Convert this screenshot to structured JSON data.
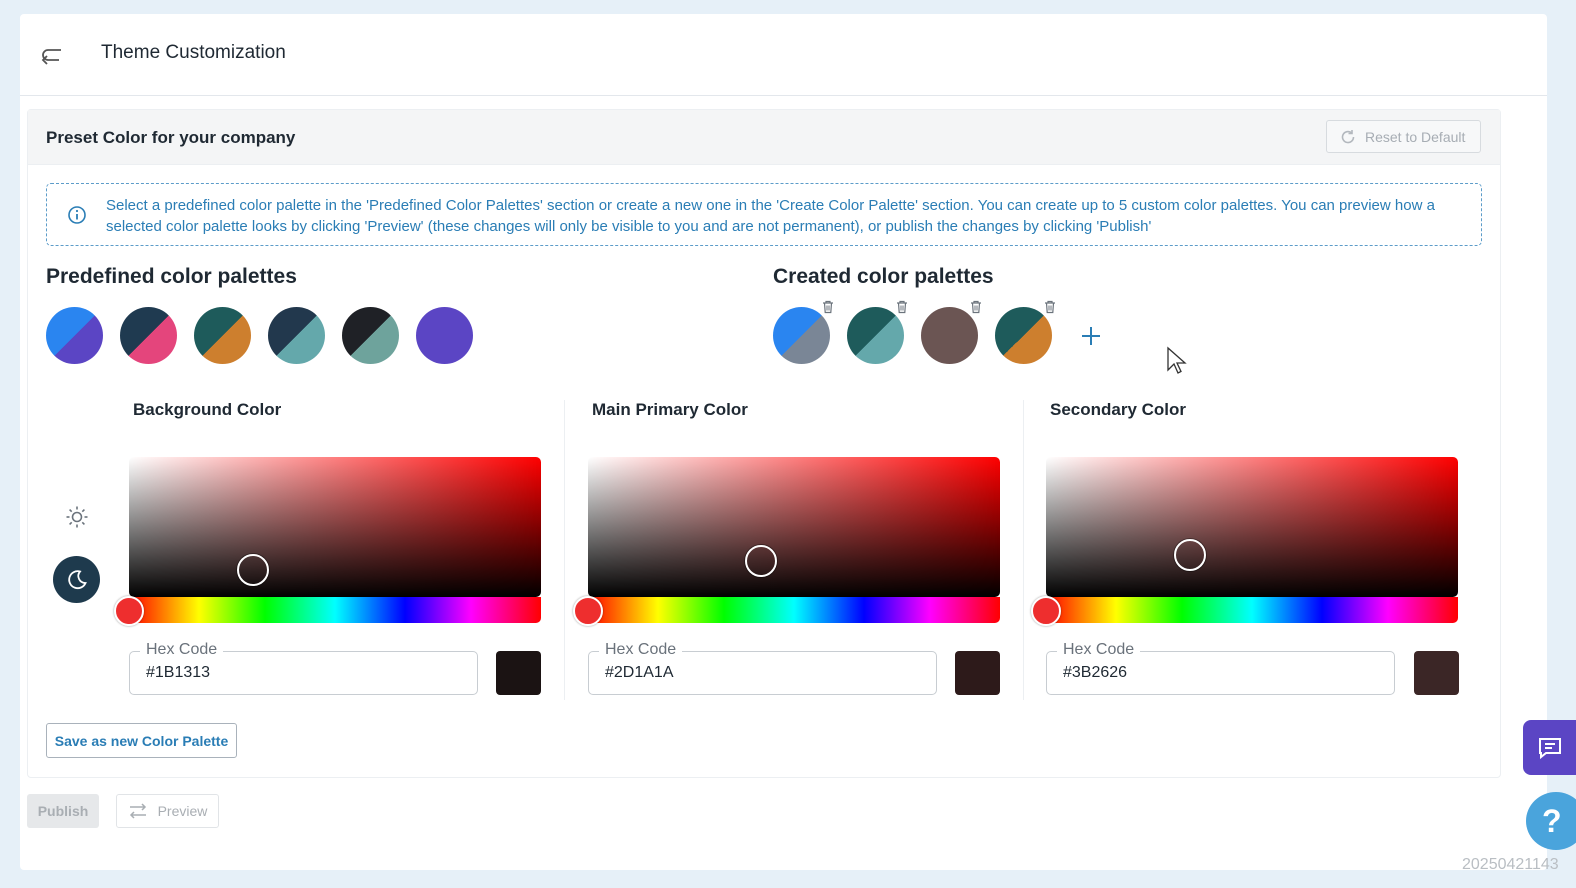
{
  "header": {
    "title": "Theme Customization"
  },
  "preset": {
    "title": "Preset Color for your company",
    "reset_label": "Reset to Default"
  },
  "info": {
    "text": "Select a predefined color palette in the 'Predefined Color Palettes' section or create a new one in the 'Create Color Palette' section. You can create up to 5 custom color palettes. You can preview how a selected color palette looks by clicking 'Preview' (these changes will only be visible to you and are not permanent), or publish the changes by clicking 'Publish'"
  },
  "predefined": {
    "title": "Predefined color palettes",
    "palettes": [
      {
        "a": "#2a85f0",
        "b": "#5b45c4"
      },
      {
        "a": "#1f3a50",
        "b": "#e4457c"
      },
      {
        "a": "#1e5b5b",
        "b": "#cd7f2e"
      },
      {
        "a": "#22384d",
        "b": "#64a8ab"
      },
      {
        "a": "#1f2126",
        "b": "#6ea39c"
      },
      {
        "a": "#5b45c4",
        "b": "#5b45c4"
      }
    ]
  },
  "created": {
    "title": "Created color palettes",
    "palettes": [
      {
        "a": "#2a85f0",
        "b": "#7a8696"
      },
      {
        "a": "#1e5b5b",
        "b": "#64a8ab"
      },
      {
        "a": "#6b5553",
        "b": "#6b5553"
      },
      {
        "a": "#1e5b5b",
        "b": "#cd7f2e"
      }
    ]
  },
  "colors": [
    {
      "title": "Background Color",
      "hex_label": "Hex Code",
      "hex": "#1B1313"
    },
    {
      "title": "Main Primary Color",
      "hex_label": "Hex Code",
      "hex": "#2D1A1A"
    },
    {
      "title": "Secondary Color",
      "hex_label": "Hex Code",
      "hex": "#3B2626"
    }
  ],
  "actions": {
    "save_palette": "Save as new Color Palette",
    "publish": "Publish",
    "preview": "Preview"
  },
  "footer": {
    "stamp": "20250421143"
  }
}
